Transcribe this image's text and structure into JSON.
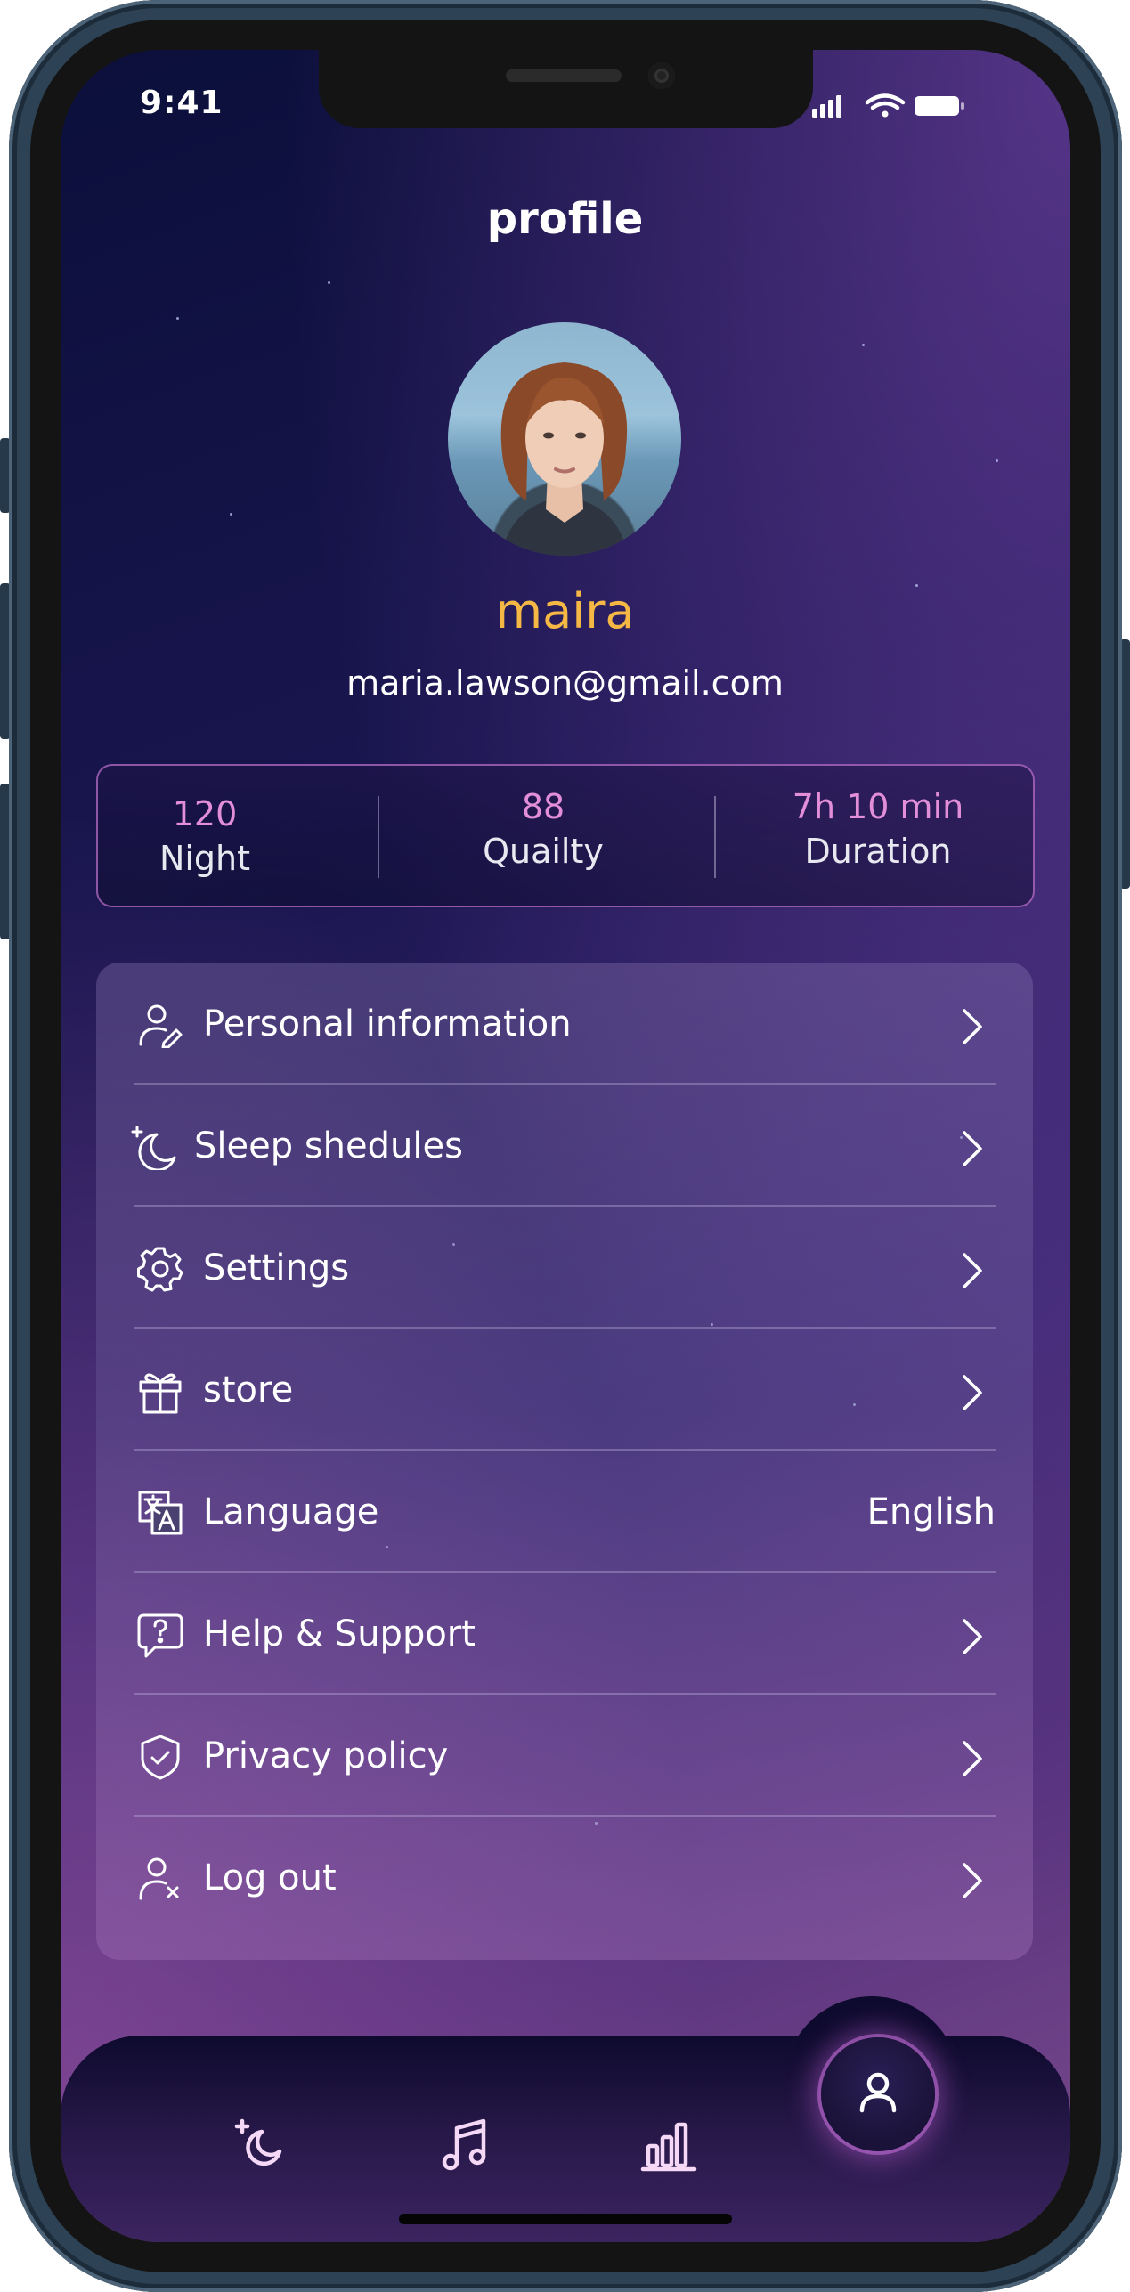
{
  "status_bar": {
    "time": "9:41"
  },
  "header": {
    "title": "profile"
  },
  "user": {
    "name": "maira",
    "email": "maria.lawson@gmail.com"
  },
  "stats": [
    {
      "value": "120",
      "label": "Night"
    },
    {
      "value": "88",
      "label": "Quailty"
    },
    {
      "value": "7h 10 min",
      "label": "Duration"
    }
  ],
  "menu": {
    "items": [
      {
        "label": "Personal information",
        "icon": "user-edit-icon"
      },
      {
        "label": "Sleep shedules",
        "icon": "moon-icon"
      },
      {
        "label": "Settings",
        "icon": "gear-icon"
      },
      {
        "label": "store",
        "icon": "gift-icon"
      },
      {
        "label": "Language",
        "icon": "translate-icon",
        "value": "English"
      },
      {
        "label": "Help & Support",
        "icon": "help-chat-icon"
      },
      {
        "label": "Privacy policy",
        "icon": "shield-check-icon"
      },
      {
        "label": "Log out",
        "icon": "user-x-icon"
      }
    ]
  },
  "tabbar": {
    "tabs": [
      {
        "icon": "moon-icon"
      },
      {
        "icon": "music-icon"
      },
      {
        "icon": "chart-icon"
      },
      {
        "icon": "profile-icon",
        "active": true
      }
    ]
  },
  "colors": {
    "accent_name": "#f5b845",
    "stat_value": "#e38ed8"
  }
}
